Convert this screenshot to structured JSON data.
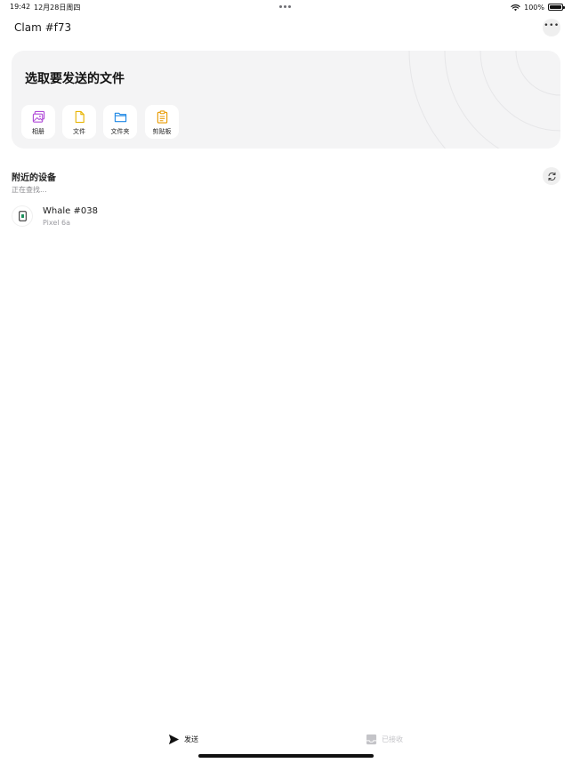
{
  "status_bar": {
    "time": "19:42",
    "date": "12月28日周四",
    "battery": "100%",
    "icons": [
      "wifi-icon",
      "battery-icon"
    ]
  },
  "header": {
    "title": "Clam #f73",
    "more_icon": "ellipsis-icon"
  },
  "send_card": {
    "title": "选取要发送的文件",
    "options": [
      {
        "label": "相册",
        "icon": "photo-icon",
        "color": "#b04ad8"
      },
      {
        "label": "文件",
        "icon": "file-icon",
        "color": "#e8b400"
      },
      {
        "label": "文件夹",
        "icon": "folder-icon",
        "color": "#1e88e5"
      },
      {
        "label": "剪贴板",
        "icon": "clipboard-icon",
        "color": "#e89a00"
      }
    ]
  },
  "nearby": {
    "title": "附近的设备",
    "status": "正在查找...",
    "refresh_icon": "refresh-icon",
    "devices": [
      {
        "name": "Whale #038",
        "model": "Pixel 6a",
        "icon": "phone-icon",
        "accent": "#1a8f5a"
      }
    ]
  },
  "tabs": [
    {
      "label": "发送",
      "icon": "send-icon",
      "active": true
    },
    {
      "label": "已接收",
      "icon": "inbox-icon",
      "active": false
    }
  ],
  "colors": {
    "card_background": "#f4f4f5",
    "active_tab": "#111111",
    "inactive_tab": "#c4c4c8"
  }
}
